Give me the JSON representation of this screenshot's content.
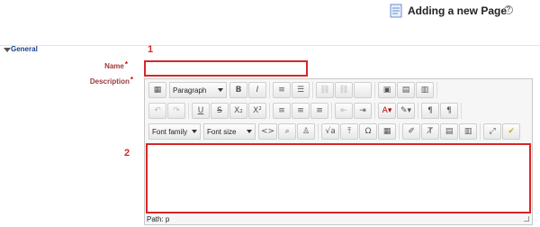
{
  "header": {
    "title": "Adding a new Page",
    "help_icon": "help-icon",
    "page_icon": "page-icon"
  },
  "section": {
    "title": "General"
  },
  "fields": {
    "name_label": "Name",
    "description_label": "Description",
    "required_mark": "*",
    "name_value": ""
  },
  "annotations": {
    "one": "1",
    "two": "2"
  },
  "editor": {
    "paragraph_select": "Paragraph",
    "font_family_select": "Font family",
    "font_size_select": "Font size",
    "path_text": "Path: p"
  },
  "colors": {
    "annotation_red": "#d62728",
    "label_red": "#a03a3a",
    "section_blue": "#1a3f8a"
  }
}
